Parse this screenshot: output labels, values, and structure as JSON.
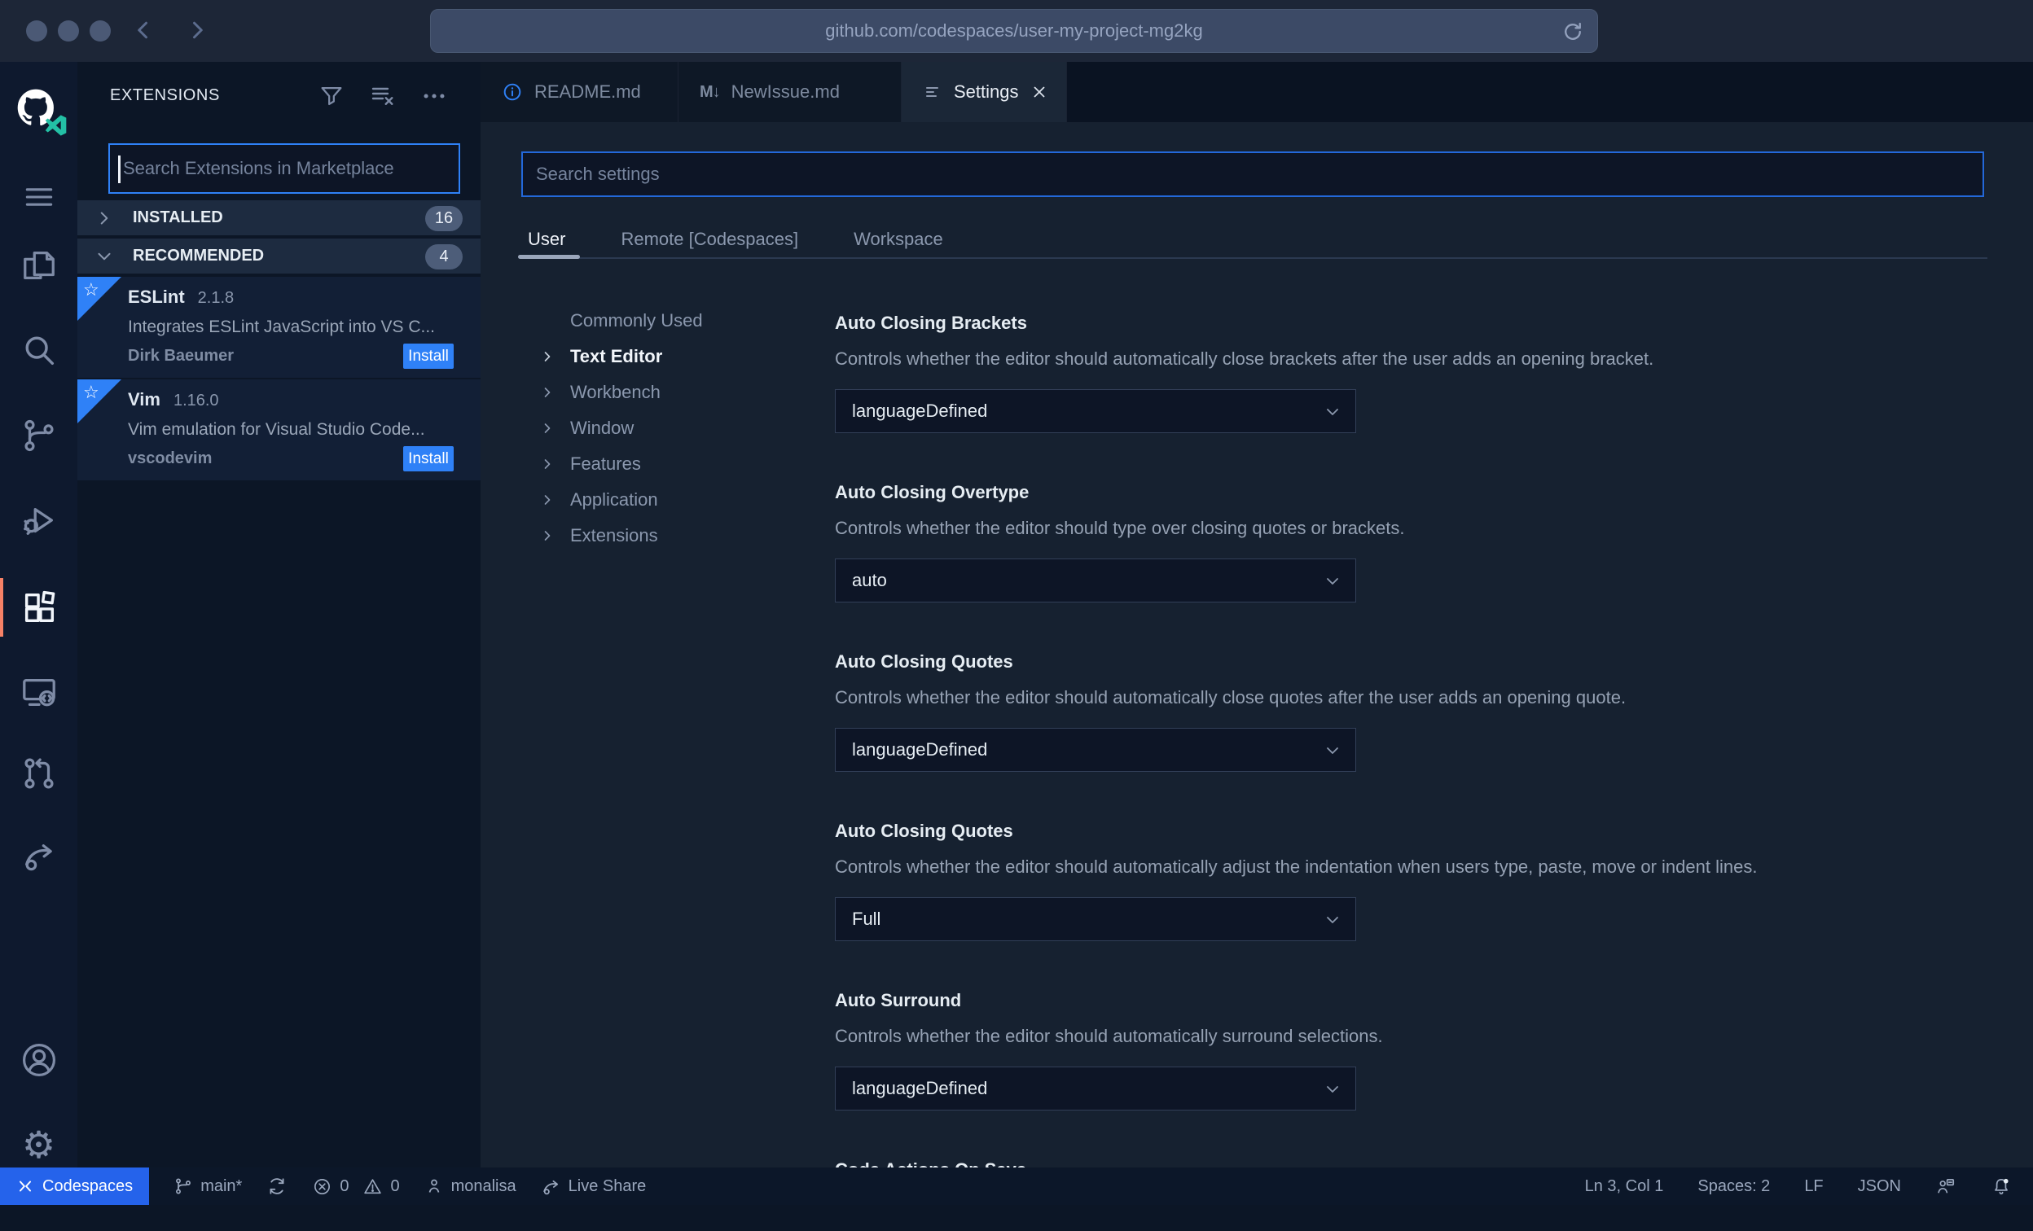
{
  "browser": {
    "url": "github.com/codespaces/user-my-project-mg2kg"
  },
  "activity_bar": {
    "icons": [
      "github-codespaces-logo",
      "menu",
      "explorer",
      "search",
      "source-control",
      "run-and-debug",
      "extensions",
      "remote-explorer",
      "pull-requests",
      "live-share",
      "account",
      "settings-gear"
    ],
    "active_icon": "extensions"
  },
  "extensions_panel": {
    "title": "EXTENSIONS",
    "header_icons": [
      "filter",
      "clear-search-results",
      "more-actions"
    ],
    "search_placeholder": "Search Extensions in Marketplace",
    "search_value": "",
    "sections": [
      {
        "label": "INSTALLED",
        "count": "16"
      },
      {
        "label": "RECOMMENDED",
        "count": "4"
      }
    ],
    "items": [
      {
        "name": "ESLint",
        "version": "2.1.8",
        "description": "Integrates ESLint JavaScript into VS C...",
        "publisher": "Dirk Baeumer",
        "action": "Install"
      },
      {
        "name": "Vim",
        "version": "1.16.0",
        "description": "Vim emulation for Visual Studio Code...",
        "publisher": "vscodevim",
        "action": "Install"
      }
    ]
  },
  "editor_tabs": [
    {
      "label": "README.md",
      "icon": "info"
    },
    {
      "label": "NewIssue.md",
      "icon": "markdown",
      "icon_text": "M↓"
    },
    {
      "label": "Settings",
      "icon": "settings-sliders",
      "active": true
    }
  ],
  "settings_page": {
    "search_placeholder": "Search settings",
    "scope_tabs": [
      {
        "label": "User",
        "active": true
      },
      {
        "label": "Remote [Codespaces]"
      },
      {
        "label": "Workspace"
      }
    ],
    "toc": [
      {
        "label": "Commonly Used"
      },
      {
        "label": "Text Editor",
        "active": true
      },
      {
        "label": "Workbench"
      },
      {
        "label": "Window"
      },
      {
        "label": "Features"
      },
      {
        "label": "Application"
      },
      {
        "label": "Extensions"
      }
    ],
    "items": [
      {
        "title": "Auto Closing Brackets",
        "description": "Controls whether the editor should automatically close brackets after the user adds an opening bracket.",
        "value": "languageDefined"
      },
      {
        "title": "Auto Closing Overtype",
        "description": "Controls whether the editor should type over closing quotes or brackets.",
        "value": "auto"
      },
      {
        "title": "Auto Closing Quotes",
        "description": "Controls whether the editor should automatically close quotes after the user adds an opening quote.",
        "value": "languageDefined"
      },
      {
        "title": "Auto Closing Quotes",
        "description": "Controls whether the editor should automatically adjust the indentation when users type, paste, move or indent lines.",
        "value": "Full"
      },
      {
        "title": "Auto Surround",
        "description": "Controls whether the editor should automatically surround selections.",
        "value": "languageDefined"
      },
      {
        "title": "Code Actions On Save"
      }
    ]
  },
  "status_bar": {
    "remote_label": "Codespaces",
    "branch": "main*",
    "errors": "0",
    "warnings": "0",
    "user": "monalisa",
    "live_share": "Live Share",
    "line_col": "Ln 3, Col 1",
    "indentation": "Spaces: 2",
    "eol": "LF",
    "language": "JSON"
  },
  "colors": {
    "accent_blue": "#2f81f7",
    "codespaces_blue": "#2563eb",
    "active_indicator": "#f78166",
    "vscode_teal": "#23c0a5"
  }
}
